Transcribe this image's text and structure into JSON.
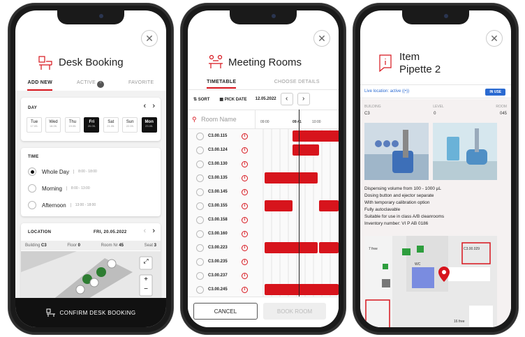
{
  "desk": {
    "title": "Desk Booking",
    "tabs": [
      "ADD NEW",
      "ACTIVE",
      "FAVORITE"
    ],
    "active_count": "4",
    "day_label": "DAY",
    "days": [
      {
        "name": "Tue",
        "date": "17.05."
      },
      {
        "name": "Wed",
        "date": "18.05."
      },
      {
        "name": "Thu",
        "date": "19.05."
      },
      {
        "name": "Fri",
        "date": "20.05."
      },
      {
        "name": "Sat",
        "date": "21.05."
      },
      {
        "name": "Sun",
        "date": "22.05."
      },
      {
        "name": "Mon",
        "date": "23.05."
      }
    ],
    "time_label": "TIME",
    "times": [
      {
        "label": "Whole Day",
        "range": "8:00 - 18:00"
      },
      {
        "label": "Morning",
        "range": "8:00 - 13:00"
      },
      {
        "label": "Afternoon",
        "range": "13:00 - 18:00"
      }
    ],
    "location_label": "LOCATION",
    "location_date": "FRI, 20.05.2022",
    "building_label": "Building",
    "building": "C3",
    "floor_label": "Floor",
    "floor": "0",
    "room_label": "Room Nr",
    "room": "45",
    "seat_label": "Seat",
    "seat": "3",
    "confirm": "CONFIRM DESK BOOKING"
  },
  "meeting": {
    "title": "Meeting Rooms",
    "tabs": [
      "TIMETABLE",
      "CHOOSE DETAILS"
    ],
    "sort": "SORT",
    "pick_date": "PICK DATE",
    "date": "12.05.2022",
    "search_placeholder": "Room Name",
    "times": [
      "09:00",
      "09:41",
      "10:00"
    ],
    "rooms": [
      "C3.00.115",
      "C3.00.124",
      "C3.00.130",
      "C3.00.135",
      "C3.00.145",
      "C3.00.155",
      "C3.00.158",
      "C3.00.160",
      "C3.00.223",
      "C3.00.235",
      "C3.00.237",
      "C3.00.245"
    ],
    "cancel": "CANCEL",
    "book": "BOOK ROOM"
  },
  "item": {
    "title_line1": "Item",
    "title_line2": "Pipette 2",
    "live": "Live location: active",
    "status": "IN USE",
    "building_label": "BUILDING",
    "building": "C3",
    "level_label": "LEVEL",
    "level": "0",
    "room_label": "ROOM",
    "room": "045",
    "description": [
      "Dispensing volume from 100 - 1000 µL",
      "Dosing button and ejector separate",
      "With temporary calibration option",
      "Fully autoclavable",
      "Suitable for use in class A/B cleanrooms",
      "Inventory number: VI P AB 0186"
    ],
    "map_labels": {
      "free1": "7 free",
      "room": "C3.00.029",
      "wc": "WC",
      "free2": "16 free"
    }
  },
  "colors": {
    "accent": "#d7141c",
    "dark": "#111111"
  }
}
